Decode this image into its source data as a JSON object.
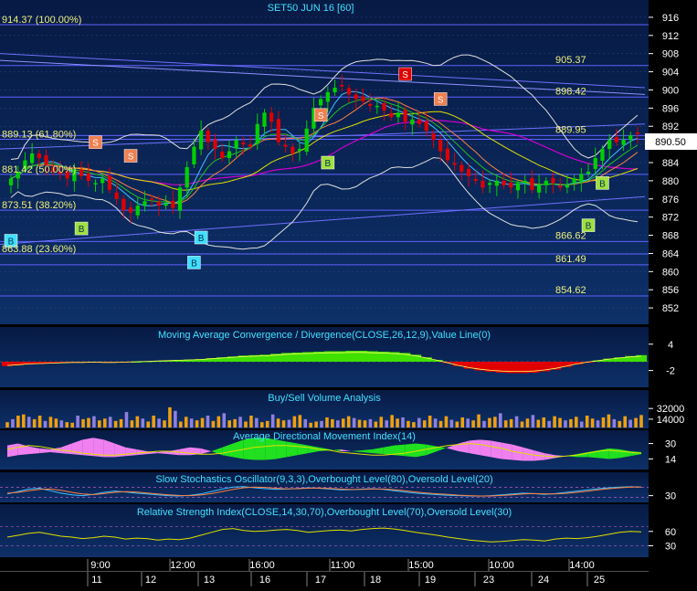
{
  "chart_data": [
    {
      "type": "candlestick",
      "title": "SET50 JUN 16  [60]",
      "ylim": [
        849,
        919
      ],
      "yticks": [
        852,
        856,
        860,
        864,
        868,
        872,
        876,
        880,
        884,
        888,
        892,
        896,
        900,
        904,
        908,
        912,
        916
      ],
      "last_price": "890.50",
      "fib_levels": [
        {
          "label": "914.37 (100.00%)",
          "value": 914.37
        },
        {
          "label": "889.13 (61.80%)",
          "value": 889.13
        },
        {
          "label": "881.42 (50.00%)",
          "value": 881.42
        },
        {
          "label": "873.51 (38.20%)",
          "value": 873.51
        },
        {
          "label": "863.88 (23.60%)",
          "value": 863.88
        }
      ],
      "price_levels": [
        {
          "label": "905.37",
          "value": 905.37
        },
        {
          "label": "898.42",
          "value": 898.42
        },
        {
          "label": "889.95",
          "value": 889.95
        },
        {
          "label": "866.62",
          "value": 866.62
        },
        {
          "label": "861.49",
          "value": 861.49
        },
        {
          "label": "854.62",
          "value": 854.62
        }
      ],
      "close": [
        880.5,
        882.0,
        884.5,
        886.0,
        885.0,
        883.5,
        882.0,
        881.5,
        880.5,
        882.5,
        881.0,
        880.0,
        879.5,
        880.5,
        878.0,
        876.0,
        873.5,
        873.0,
        874.5,
        875.5,
        876.0,
        874.5,
        875.0,
        874.0,
        878.5,
        883.0,
        887.5,
        891.0,
        888.5,
        887.0,
        885.0,
        886.5,
        889.0,
        888.0,
        887.5,
        892.5,
        895.0,
        893.0,
        888.5,
        887.5,
        886.0,
        887.0,
        891.5,
        896.0,
        898.0,
        899.5,
        900.5,
        901.0,
        899.0,
        898.0,
        897.5,
        896.5,
        896.5,
        895.5,
        894.0,
        895.0,
        893.0,
        893.5,
        892.5,
        891.0,
        889.0,
        886.5,
        884.5,
        883.5,
        882.0,
        881.0,
        880.0,
        878.5,
        879.5,
        880.0,
        879.0,
        878.5,
        879.5,
        880.0,
        878.0,
        879.0,
        880.0,
        879.5,
        878.5,
        879.0,
        880.5,
        881.5,
        882.0,
        885.0,
        887.0,
        889.0,
        888.5,
        889.0,
        890.0,
        890.5
      ],
      "signals": [
        {
          "type": "B",
          "index": 0,
          "value": 866.8
        },
        {
          "type": "B",
          "index": 11,
          "value": 869.5
        },
        {
          "type": "S",
          "index": 13,
          "value": 888.5
        },
        {
          "type": "S",
          "index": 19,
          "value": 885.5
        },
        {
          "type": "B",
          "index": 29,
          "value": 862.0
        },
        {
          "type": "B",
          "index": 30,
          "value": 867.5
        },
        {
          "type": "S",
          "index": 49,
          "value": 894.5
        },
        {
          "type": "B",
          "index": 51,
          "value": 884.0
        },
        {
          "type": "S",
          "index": 63,
          "value": 903.5
        },
        {
          "type": "S",
          "index": 69,
          "value": 898.0
        },
        {
          "type": "B",
          "index": 92,
          "value": 870.2
        },
        {
          "type": "B",
          "index": 94,
          "value": 879.5
        }
      ]
    },
    {
      "type": "bar",
      "title": "Moving Average Convergence / Divergence(CLOSE,26,12,9),Value Line(0)",
      "ylim": [
        -5,
        5
      ],
      "yticks": [
        4,
        -2
      ],
      "values": [
        -1.0,
        -0.8,
        -0.6,
        -0.5,
        -0.4,
        -0.3,
        -0.2,
        -0.2,
        -0.1,
        -0.2,
        -0.2,
        -0.1,
        0.0,
        0.1,
        0.2,
        0.3,
        0.4,
        0.5,
        0.6,
        0.8,
        1.0,
        1.2,
        1.4,
        1.5,
        1.6,
        1.8,
        2.0,
        2.1,
        2.2,
        2.3,
        2.4,
        2.4,
        2.5,
        2.5,
        2.4,
        2.3,
        2.2,
        2.0,
        1.6,
        1.0,
        0.4,
        -0.3,
        -1.0,
        -1.6,
        -2.0,
        -2.3,
        -2.5,
        -2.6,
        -2.6,
        -2.5,
        -2.2,
        -1.8,
        -1.2,
        -0.6,
        -0.1,
        0.3,
        0.7,
        1.0,
        1.3,
        1.5
      ]
    },
    {
      "type": "bar",
      "title": "Buy/Sell Volume Analysis",
      "ylim": [
        0,
        40000
      ],
      "yticks": [
        32000,
        14000
      ],
      "values": [
        9000,
        14000,
        20000,
        22000,
        18000,
        14000,
        20000,
        11000,
        18000,
        15000,
        12000,
        9000,
        8000,
        20000,
        14000,
        16000,
        19000,
        12000,
        15000,
        18000,
        11000,
        14000,
        26000,
        12000,
        19000,
        15000,
        10000,
        20000,
        15000,
        12000,
        34000,
        28000,
        10000,
        18000,
        15000,
        12000,
        16000,
        20000,
        11000,
        19000,
        24000,
        12000,
        14000,
        18000,
        10000,
        20000,
        16000,
        9000,
        11000,
        22000,
        15000,
        12000,
        13000,
        19000,
        21000,
        14000,
        8000,
        10000,
        11000,
        17000,
        14000,
        12000,
        15000,
        19000,
        16000,
        13000,
        12000,
        14000,
        10000,
        18000,
        12000,
        21000,
        15000,
        17000,
        11000,
        9000,
        16000,
        12000,
        20000,
        15000,
        11000,
        19000,
        13000,
        10000,
        17000,
        15000,
        12000,
        22000,
        11000,
        16000,
        18000,
        24000,
        12000,
        14000,
        19000,
        10000,
        15000,
        21000,
        13000,
        17000,
        11000,
        19000,
        16000,
        12000,
        14000,
        18000,
        10000,
        20000,
        15000,
        12000,
        17000,
        22000,
        14000,
        11000,
        19000,
        13000,
        16000,
        21000
      ]
    },
    {
      "type": "area",
      "title": "Average Directional Movement Index(14)",
      "ylim": [
        4,
        40
      ],
      "yticks": [
        30,
        14
      ],
      "adx": [
        24,
        26,
        28,
        27,
        25,
        23,
        22,
        20,
        19,
        18,
        18,
        19,
        20,
        21,
        22,
        22,
        21,
        20,
        19,
        19,
        20,
        22,
        24,
        26,
        27,
        28,
        28,
        27,
        26,
        24,
        23,
        21,
        20,
        19,
        18,
        18,
        19,
        20,
        22,
        24,
        26,
        28,
        29,
        30,
        29,
        27,
        25,
        22,
        20,
        18,
        17,
        16,
        17,
        18,
        20,
        22,
        23,
        22,
        21,
        20
      ],
      "di_plus": [
        16,
        18,
        19,
        20,
        21,
        20,
        19,
        18,
        17,
        16,
        16,
        17,
        18,
        19,
        20,
        19,
        18,
        18,
        19,
        22,
        26,
        30,
        34,
        36,
        36,
        34,
        32,
        30,
        28,
        26,
        24,
        22,
        22,
        23,
        24,
        26,
        28,
        29,
        30,
        29,
        27,
        25,
        22,
        20,
        18,
        16,
        14,
        13,
        12,
        12,
        13,
        15,
        17,
        19,
        21,
        23,
        25,
        24,
        22,
        21
      ],
      "di_minus": [
        28,
        30,
        27,
        25,
        24,
        26,
        30,
        34,
        36,
        34,
        30,
        26,
        24,
        22,
        21,
        22,
        24,
        26,
        25,
        22,
        18,
        16,
        14,
        13,
        13,
        14,
        16,
        18,
        20,
        22,
        23,
        24,
        22,
        21,
        20,
        19,
        18,
        17,
        16,
        18,
        22,
        26,
        30,
        33,
        34,
        33,
        31,
        29,
        26,
        23,
        20,
        18,
        17,
        16,
        16,
        15,
        14,
        15,
        17,
        19
      ]
    },
    {
      "type": "line",
      "title": "Slow Stochastics Oscillator(9,3,3),Overbought Level(80),Oversold Level(20)",
      "ylim": [
        0,
        100
      ],
      "yticks": [
        30
      ],
      "k": [
        40,
        55,
        70,
        75,
        60,
        45,
        35,
        30,
        38,
        50,
        58,
        52,
        45,
        40,
        35,
        30,
        28,
        32,
        40,
        55,
        70,
        82,
        85,
        78,
        72,
        68,
        70,
        74,
        78,
        75,
        70,
        65,
        66,
        70,
        72,
        68,
        60,
        52,
        45,
        40,
        36,
        32,
        30,
        28,
        27,
        30,
        35,
        40,
        45,
        42,
        38,
        42,
        50,
        58,
        65,
        72,
        78,
        82,
        84,
        82
      ],
      "d": [
        45,
        50,
        60,
        68,
        70,
        62,
        50,
        40,
        36,
        42,
        50,
        54,
        52,
        46,
        40,
        35,
        31,
        30,
        34,
        42,
        55,
        68,
        78,
        82,
        80,
        75,
        71,
        72,
        75,
        76,
        74,
        70,
        67,
        68,
        70,
        70,
        66,
        60,
        52,
        46,
        41,
        37,
        33,
        30,
        28,
        28,
        31,
        35,
        40,
        42,
        41,
        40,
        44,
        50,
        57,
        65,
        72,
        78,
        82,
        83
      ]
    },
    {
      "type": "line",
      "title": "Relative Strength Index(CLOSE,14,30,70),Overbought Level(70),Oversold Level(30)",
      "ylim": [
        10,
        90
      ],
      "yticks": [
        60,
        30
      ],
      "values": [
        48,
        52,
        56,
        58,
        54,
        50,
        48,
        45,
        47,
        50,
        48,
        44,
        46,
        45,
        42,
        44,
        43,
        46,
        52,
        58,
        64,
        66,
        62,
        60,
        61,
        63,
        64,
        62,
        58,
        60,
        62,
        63,
        61,
        64,
        66,
        67,
        65,
        62,
        58,
        55,
        52,
        48,
        45,
        42,
        40,
        38,
        39,
        41,
        43,
        42,
        40,
        44,
        46,
        45,
        47,
        50,
        54,
        58,
        60,
        59
      ]
    }
  ],
  "time_axis": {
    "hour_labels": [
      "9:00",
      "12:00",
      "16:00",
      "11:00",
      "15:00",
      "10:00",
      "14:00"
    ],
    "day_labels": [
      "11",
      "12",
      "13",
      "16",
      "17",
      "18",
      "19",
      "23",
      "24",
      "25"
    ]
  },
  "colors": {
    "panel_bg": "#0a2a5c",
    "grid": "#2a4a88",
    "bull": "#00d000",
    "bear": "#e00000",
    "text_yellow": "#f0f080",
    "text_cyan": "#40e0ff",
    "sell_signal": "#f08050",
    "buy_signal": "#40e0ff",
    "fib_line": "#6060ff"
  }
}
